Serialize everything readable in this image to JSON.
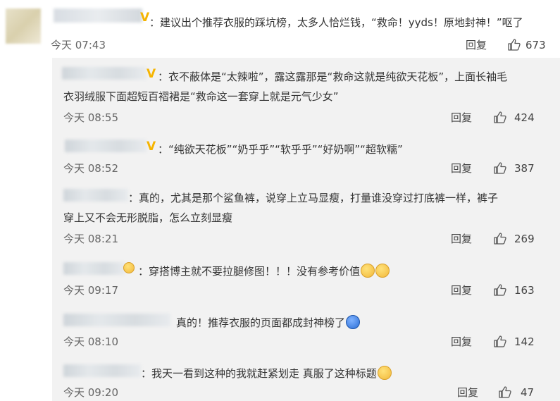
{
  "top_comment": {
    "text": "：建议出个推荐衣服的踩坑榜，太多人恰烂钱，“救命！yyds！原地封神！”呕了",
    "time": "今天 07:43",
    "reply_label": "回复",
    "likes": "673"
  },
  "replies": [
    {
      "line1": "：衣不蔽体是“太辣啦”，露这露那是“救命这就是纯欲天花板”，上面长袖毛",
      "line2": "衣羽绒服下面超短百褶裙是“救命这一套穿上就是元气少女”",
      "time": "今天 08:55",
      "reply_label": "回复",
      "likes": "424"
    },
    {
      "line1": "：“纯欲天花板”“奶乎乎”“软乎乎”“好奶啊”“超软糯”",
      "time": "今天 08:52",
      "reply_label": "回复",
      "likes": "387"
    },
    {
      "line1": "：真的，尤其是那个鲨鱼裤，说穿上立马显瘦，打量谁没穿过打底裤一样，裤子",
      "line2": "穿上又不会无形脱脂，怎么立刻显瘦",
      "time": "今天 08:21",
      "reply_label": "回复",
      "likes": "269"
    },
    {
      "line1": "：穿搭博主就不要拉腿修图！！！没有参考价值",
      "time": "今天 09:17",
      "reply_label": "回复",
      "likes": "163"
    },
    {
      "line1": "真的！推荐衣服的页面都成封神榜了",
      "time": "今天 08:10",
      "reply_label": "回复",
      "likes": "142"
    },
    {
      "line1": "：我天一看到这种的我就赶紧划走 真服了这种标题",
      "time": "今天 09:20",
      "reply_label": "回复",
      "likes": "47"
    }
  ],
  "icons": {
    "like": "thumbs-up-icon",
    "vip": "vip-v-badge-icon",
    "emoji": "emoji-icon"
  },
  "colors": {
    "reply_background": "#f2f2f2",
    "vip_badge": "#f5b400"
  }
}
